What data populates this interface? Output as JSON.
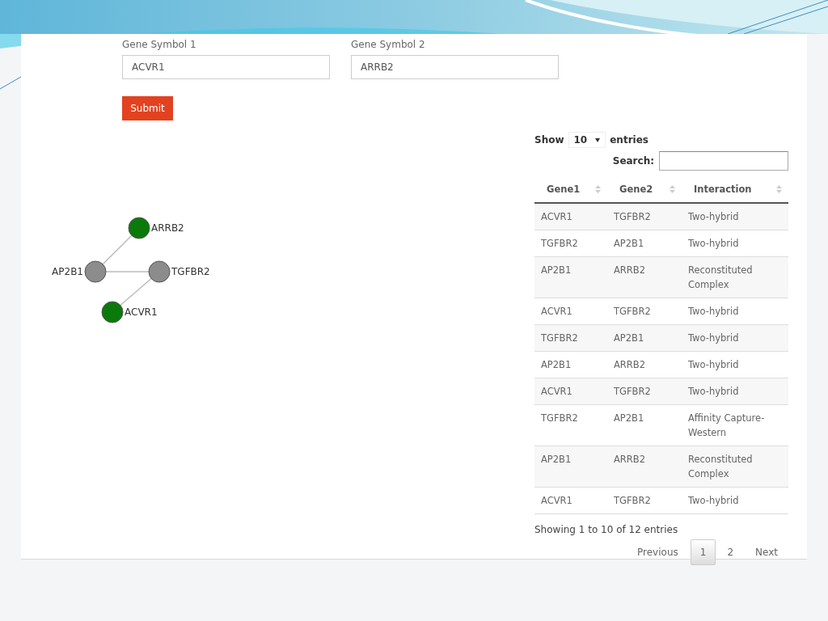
{
  "form": {
    "fields": [
      {
        "label": "Gene Symbol 1",
        "value": "ACVR1"
      },
      {
        "label": "Gene Symbol 2",
        "value": "ARRB2"
      }
    ],
    "submit": "Submit"
  },
  "graph": {
    "nodes": [
      {
        "label": "ARRB2",
        "color": "#0a7a0a"
      },
      {
        "label": "AP2B1",
        "color": "#8c8c8c"
      },
      {
        "label": "TGFBR2",
        "color": "#8c8c8c"
      },
      {
        "label": "ACVR1",
        "color": "#0a7a0a"
      }
    ]
  },
  "table": {
    "length": {
      "before": "Show",
      "value": "10",
      "after": "entries"
    },
    "search_label": "Search:",
    "columns": [
      "Gene1",
      "Gene2",
      "Interaction"
    ],
    "rows": [
      [
        "ACVR1",
        "TGFBR2",
        "Two-hybrid"
      ],
      [
        "TGFBR2",
        "AP2B1",
        "Two-hybrid"
      ],
      [
        "AP2B1",
        "ARRB2",
        "Reconstituted Complex"
      ],
      [
        "ACVR1",
        "TGFBR2",
        "Two-hybrid"
      ],
      [
        "TGFBR2",
        "AP2B1",
        "Two-hybrid"
      ],
      [
        "AP2B1",
        "ARRB2",
        "Two-hybrid"
      ],
      [
        "ACVR1",
        "TGFBR2",
        "Two-hybrid"
      ],
      [
        "TGFBR2",
        "AP2B1",
        "Affinity Capture-Western"
      ],
      [
        "AP2B1",
        "ARRB2",
        "Reconstituted Complex"
      ],
      [
        "ACVR1",
        "TGFBR2",
        "Two-hybrid"
      ]
    ],
    "info": "Showing 1 to 10 of 12 entries",
    "pagination": {
      "previous": "Previous",
      "pages": [
        {
          "label": "1",
          "selected": true
        },
        {
          "label": "2",
          "selected": false
        }
      ],
      "next": "Next"
    }
  }
}
